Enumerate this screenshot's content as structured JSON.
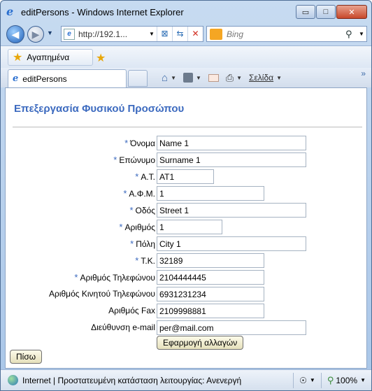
{
  "window": {
    "title": "editPersons - Windows Internet Explorer",
    "minimize_glyph": "▭",
    "maximize_glyph": "□",
    "close_glyph": "✕"
  },
  "address": {
    "url": "http://192.1...",
    "search_placeholder": "Bing"
  },
  "favorites": {
    "label": "Αγαπημένα"
  },
  "tabs": [
    {
      "label": "editPersons"
    }
  ],
  "commands": {
    "page_label": "Σελίδα",
    "overflow": "»"
  },
  "form": {
    "title": "Επεξεργασία Φυσικού Προσώπου",
    "required_mark": "*",
    "fields": [
      {
        "label": "Όνομα",
        "value": "Name 1",
        "required": true
      },
      {
        "label": "Επώνυμο",
        "value": "Surname 1",
        "required": true
      },
      {
        "label": "Α.Τ.",
        "value": "AT1",
        "required": true
      },
      {
        "label": "Α.Φ.Μ.",
        "value": "1",
        "required": true
      },
      {
        "label": "Οδός",
        "value": "Street 1",
        "required": true
      },
      {
        "label": "Αριθμός",
        "value": "1",
        "required": true
      },
      {
        "label": "Πόλη",
        "value": "City 1",
        "required": true
      },
      {
        "label": "Τ.Κ.",
        "value": "32189",
        "required": true
      },
      {
        "label": "Αριθμός Τηλεφώνου",
        "value": "2104444445",
        "required": true
      },
      {
        "label": "Αριθμός Κινητού Τηλεφώνου",
        "value": "6931231234",
        "required": false
      },
      {
        "label": "Αριθμός Fax",
        "value": "2109998881",
        "required": false
      },
      {
        "label": "Διεύθυνση e-mail",
        "value": "per@mail.com",
        "required": false
      }
    ],
    "apply_label": "Εφαρμογή αλλαγών",
    "back_label": "Πίσω"
  },
  "status": {
    "text": "Internet | Προστατευμένη κατάσταση λειτουργίας: Ανενεργή",
    "zoom": "100%"
  },
  "colors": {
    "title_blue": "#3c6abf",
    "required_blue": "#3c6abf"
  }
}
